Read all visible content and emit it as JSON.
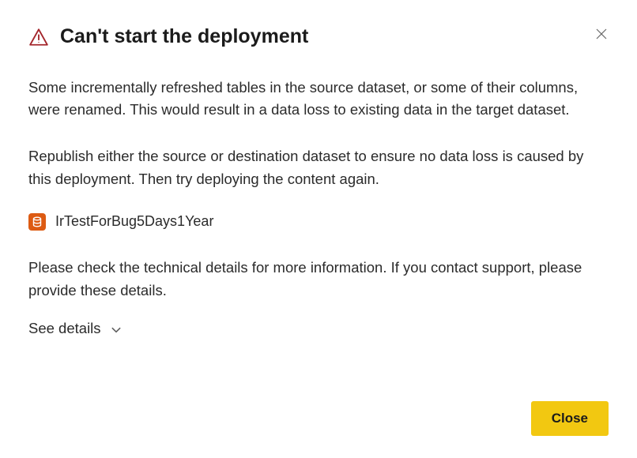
{
  "dialog": {
    "title": "Can't start the deployment",
    "paragraph1": "Some incrementally refreshed tables in the source dataset, or some of their columns, were renamed. This would result in a data loss to existing data in the target dataset.",
    "paragraph2": "Republish either the source or destination dataset to ensure no data loss is caused by this deployment. Then try deploying the content again.",
    "dataset_name": "IrTestForBug5Days1Year",
    "paragraph3": "Please check the technical details for more information. If you contact support, please provide these details.",
    "details_label": "See details",
    "close_button_label": "Close"
  },
  "colors": {
    "warning": "#a4262c",
    "dataset_icon": "#dd5b13",
    "primary_button": "#f2c811"
  }
}
